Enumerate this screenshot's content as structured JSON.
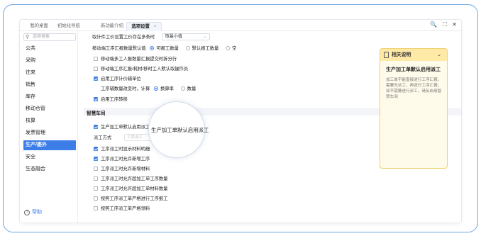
{
  "tabs": [
    {
      "label": "我的桌面"
    },
    {
      "label": "初始化导航"
    },
    {
      "label": "新功能介绍"
    },
    {
      "label": "选项设置",
      "close": "×"
    }
  ],
  "window_controls": {
    "search": "🔍",
    "expand": "⛶",
    "close": "✕"
  },
  "sidebar": {
    "search_placeholder": "选项搜索",
    "items": [
      {
        "label": "公共"
      },
      {
        "label": "采购"
      },
      {
        "label": "往来"
      },
      {
        "label": "销售"
      },
      {
        "label": "库存"
      },
      {
        "label": "移动仓管"
      },
      {
        "label": "核算"
      },
      {
        "label": "发票管理"
      },
      {
        "label": "生产/委外",
        "active": true
      },
      {
        "label": "安全"
      },
      {
        "label": "生态融合"
      }
    ],
    "help": "帮助"
  },
  "settings": {
    "price_label": "取计件工价设置工价存在多条时",
    "price_value": "取最小值",
    "report_label": "移动端工序汇报数量默认值",
    "report_options": [
      {
        "label": "可报工数量",
        "selected": true
      },
      {
        "label": "默认报工数量",
        "selected": false
      },
      {
        "label": "空",
        "selected": false
      }
    ],
    "checkboxes_top": [
      {
        "label": "移动端多工人报数量汇报提交时拆分行",
        "checked": false
      },
      {
        "label": "移动端工序汇报/耗材/移时工人默认取操作员",
        "checked": false
      },
      {
        "label": "启用工序计价辅单位",
        "checked": true
      }
    ],
    "calc_label": "工序辅数量改变时，计算",
    "calc_options": [
      {
        "label": "换算率",
        "selected": true
      },
      {
        "label": "数量",
        "selected": false
      }
    ],
    "transfer": {
      "label": "启用工序转移",
      "checked": true
    },
    "section_title": "智慧车间",
    "dispatch": {
      "label": "生产加工单默认启用派工",
      "checked": true
    },
    "dispatch_method_label": "派工方式",
    "dispatch_method_placeholder": "工序派工",
    "checkboxes_bottom": [
      {
        "label": "工序派工时显示材料明细",
        "checked": true
      },
      {
        "label": "工序派工时允许新增工序",
        "checked": true
      },
      {
        "label": "工序派工时允许新增材料",
        "checked": false
      },
      {
        "label": "工序派工时允许超加工单工序数量",
        "checked": false
      },
      {
        "label": "工序派工时允许超加工单材料数量",
        "checked": false
      },
      {
        "label": "按照工序派工单严格进行工序报工",
        "checked": false
      },
      {
        "label": "按照工序派工单严格领料",
        "checked": false
      }
    ]
  },
  "lens": {
    "text": "生产加工单默认启用派工"
  },
  "panel": {
    "header": "相关说明",
    "title": "生产加工单默认启用派工",
    "description": "加工单不能直接进行工序汇报，需要先派工，再进行工序汇报；如不需要进行派工，请反启用智慧车间"
  },
  "colors": {
    "accent": "#3d7de8",
    "frame": "#6ea4e8",
    "panel_bg": "#fffbea",
    "panel_header": "#ffe9a6"
  }
}
